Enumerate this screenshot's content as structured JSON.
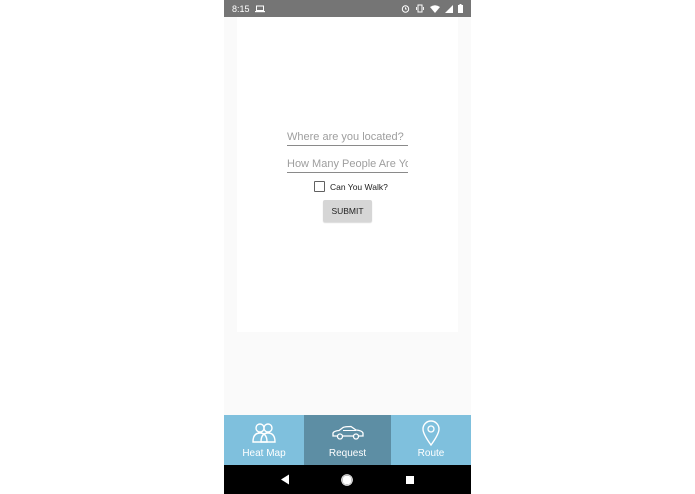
{
  "status_bar": {
    "time": "8:15",
    "left_icons": [
      "laptop-icon"
    ],
    "right_icons": [
      "alarm-icon",
      "vibrate-icon",
      "wifi-icon",
      "signal-icon",
      "battery-icon"
    ]
  },
  "form": {
    "location_placeholder": "Where are you located?",
    "people_placeholder": "How Many People Are Yo",
    "walk_label": "Can You Walk?",
    "walk_checked": false,
    "submit_label": "SUBMIT"
  },
  "tabs": [
    {
      "label": "Heat Map",
      "icon": "people-icon",
      "active": false
    },
    {
      "label": "Request",
      "icon": "car-icon",
      "active": true
    },
    {
      "label": "Route",
      "icon": "location-pin-icon",
      "active": false
    }
  ],
  "nav_bar": {
    "buttons": [
      "back-icon",
      "home-icon",
      "recents-icon"
    ]
  },
  "colors": {
    "status_bar": "#757575",
    "tab_bar": "#7fc0dd",
    "tab_active": "#5d8ea4",
    "nav_bar": "#000000"
  }
}
